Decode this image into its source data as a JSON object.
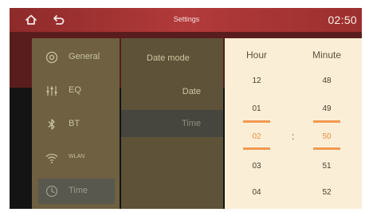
{
  "status_bar": {
    "title": "Settings",
    "clock": "02:50",
    "home_icon": "home-icon",
    "back_icon": "back-arrow-icon"
  },
  "sidebar": {
    "items": [
      {
        "label": "General",
        "icon": "gear-icon"
      },
      {
        "label": "EQ",
        "icon": "equalizer-icon"
      },
      {
        "label": "BT",
        "icon": "bluetooth-icon"
      },
      {
        "label": "WLAN",
        "icon": "wifi-icon"
      },
      {
        "label": "Time",
        "icon": "clock-icon",
        "active": true
      }
    ]
  },
  "submenu": {
    "items": [
      {
        "label": "Date mode"
      },
      {
        "label": "Date"
      },
      {
        "label": "Time",
        "active": true
      }
    ]
  },
  "time_picker": {
    "hour_header": "Hour",
    "minute_header": "Minute",
    "separator": ":",
    "hours": [
      "12",
      "01",
      "02",
      "03",
      "04"
    ],
    "minutes": [
      "48",
      "49",
      "50",
      "51",
      "52"
    ],
    "selected_hour": "02",
    "selected_minute": "50"
  },
  "colors": {
    "status_bar": "#b23a3a",
    "sidebar": "#6e6040",
    "picker_bg": "#fbeed6",
    "accent": "#ef9a52"
  }
}
